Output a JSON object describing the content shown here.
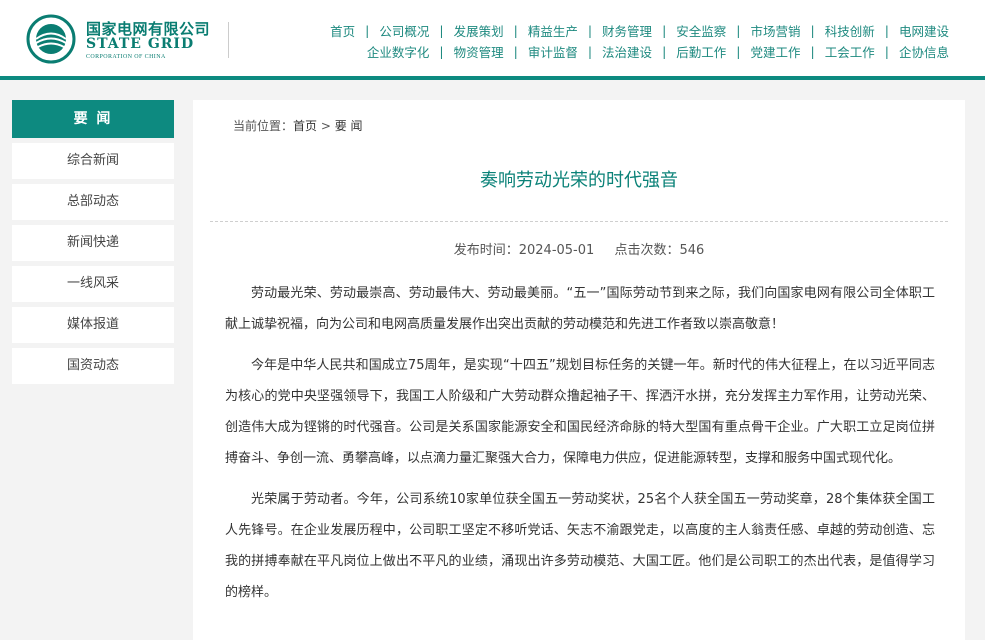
{
  "logo": {
    "cn": "国家电网有限公司",
    "en": "STATE GRID",
    "sub": "CORPORATION OF CHINA",
    "emblem_icon": "state-grid-emblem-icon",
    "brand_color": "#0d8a80"
  },
  "nav": {
    "row1": [
      "首页",
      "公司概况",
      "发展策划",
      "精益生产",
      "财务管理",
      "安全监察",
      "市场营销",
      "科技创新",
      "电网建设"
    ],
    "row2": [
      "企业数字化",
      "物资管理",
      "审计监督",
      "法治建设",
      "后勤工作",
      "党建工作",
      "工会工作",
      "企协信息"
    ],
    "separator": "|"
  },
  "sidebar": {
    "title": "要 闻",
    "items": [
      "综合新闻",
      "总部动态",
      "新闻快递",
      "一线风采",
      "媒体报道",
      "国资动态"
    ]
  },
  "breadcrumb": {
    "prefix": "当前位置：",
    "home": "首页",
    "sep": " > ",
    "current": "要 闻"
  },
  "article": {
    "title": "奏响劳动光荣的时代强音",
    "publish_label": "发布时间：2024-05-01",
    "clicks_label": "点击次数：546",
    "paragraphs": [
      "劳动最光荣、劳动最崇高、劳动最伟大、劳动最美丽。“五一”国际劳动节到来之际，我们向国家电网有限公司全体职工献上诚挚祝福，向为公司和电网高质量发展作出突出贡献的劳动模范和先进工作者致以崇高敬意！",
      "今年是中华人民共和国成立75周年，是实现“十四五”规划目标任务的关键一年。新时代的伟大征程上，在以习近平同志为核心的党中央坚强领导下，我国工人阶级和广大劳动群众撸起袖子干、挥洒汗水拼，充分发挥主力军作用，让劳动光荣、创造伟大成为铿锵的时代强音。公司是关系国家能源安全和国民经济命脉的特大型国有重点骨干企业。广大职工立足岗位拼搏奋斗、争创一流、勇攀高峰，以点滴力量汇聚强大合力，保障电力供应，促进能源转型，支撑和服务中国式现代化。",
      "光荣属于劳动者。今年，公司系统10家单位获全国五一劳动奖状，25名个人获全国五一劳动奖章，28个集体获全国工人先锋号。在企业发展历程中，公司职工坚定不移听党话、矢志不渝跟党走，以高度的主人翁责任感、卓越的劳动创造、忘我的拼搏奉献在平凡岗位上做出不平凡的业绩，涌现出许多劳动模范、大国工匠。他们是公司职工的杰出代表，是值得学习的榜样。"
    ]
  }
}
